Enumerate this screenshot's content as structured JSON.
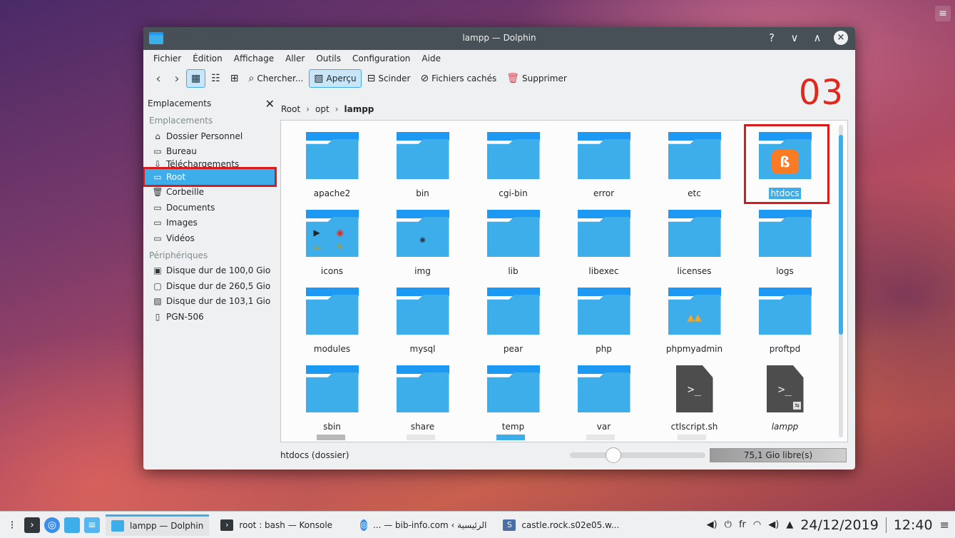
{
  "window": {
    "title": "lampp — Dolphin",
    "controls": [
      "?",
      "∨",
      "∧",
      "×"
    ]
  },
  "menubar": [
    "Fichier",
    "Édition",
    "Affichage",
    "Aller",
    "Outils",
    "Configuration",
    "Aide"
  ],
  "toolbar": {
    "search": "Chercher...",
    "preview": "Aperçu",
    "split": "Scinder",
    "hidden": "Fichiers cachés",
    "delete": "Supprimer"
  },
  "annotation": "03",
  "sidebar": {
    "header": "Emplacements",
    "close": "✕",
    "section_places": "Emplacements",
    "places": [
      {
        "label": "Dossier Personnel",
        "icon": "home-icon"
      },
      {
        "label": "Bureau",
        "icon": "desktop-icon"
      },
      {
        "label": "Téléchargements",
        "icon": "download-icon"
      },
      {
        "label": "Root",
        "icon": "folder-red-icon"
      },
      {
        "label": "Corbeille",
        "icon": "trash-icon"
      },
      {
        "label": "Documents",
        "icon": "folder-icon"
      },
      {
        "label": "Images",
        "icon": "folder-icon"
      },
      {
        "label": "Vidéos",
        "icon": "folder-icon"
      }
    ],
    "section_devices": "Périphériques",
    "devices": [
      {
        "label": "Disque dur de 100,0 Gio",
        "icon": "drive-icon"
      },
      {
        "label": "Disque dur de 260,5 Gio",
        "icon": "drive-icon"
      },
      {
        "label": "Disque dur de 103,1 Gio",
        "icon": "drive-icon"
      },
      {
        "label": "PGN-506",
        "icon": "phone-icon"
      }
    ]
  },
  "breadcrumb": [
    "Root",
    "opt",
    "lampp"
  ],
  "files": [
    {
      "name": "apache2",
      "type": "folder"
    },
    {
      "name": "bin",
      "type": "folder"
    },
    {
      "name": "cgi-bin",
      "type": "folder"
    },
    {
      "name": "error",
      "type": "folder"
    },
    {
      "name": "etc",
      "type": "folder"
    },
    {
      "name": "htdocs",
      "type": "folder-xampp",
      "selected": true
    },
    {
      "name": "icons",
      "type": "folder-icons"
    },
    {
      "name": "img",
      "type": "folder-img"
    },
    {
      "name": "lib",
      "type": "folder"
    },
    {
      "name": "libexec",
      "type": "folder"
    },
    {
      "name": "licenses",
      "type": "folder"
    },
    {
      "name": "logs",
      "type": "folder"
    },
    {
      "name": "modules",
      "type": "folder"
    },
    {
      "name": "mysql",
      "type": "folder"
    },
    {
      "name": "pear",
      "type": "folder"
    },
    {
      "name": "php",
      "type": "folder"
    },
    {
      "name": "phpmyadmin",
      "type": "folder-pma"
    },
    {
      "name": "proftpd",
      "type": "folder"
    },
    {
      "name": "sbin",
      "type": "folder"
    },
    {
      "name": "share",
      "type": "folder"
    },
    {
      "name": "temp",
      "type": "folder"
    },
    {
      "name": "var",
      "type": "folder"
    },
    {
      "name": "ctlscript.sh",
      "type": "script"
    },
    {
      "name": "lampp",
      "type": "script-link"
    }
  ],
  "statusbar": {
    "info": "htdocs (dossier)",
    "free": "75,1 Gio libre(s)",
    "zoom_fraction": 0.3
  },
  "taskbar": {
    "tasks": [
      {
        "label": "lampp — Dolphin",
        "active": true
      },
      {
        "label": "root : bash — Konsole",
        "active": false
      },
      {
        "label": "... — bib-info.com ‹ الرئيسية",
        "active": false
      },
      {
        "label": "castle.rock.s02e05.w...",
        "active": false
      }
    ],
    "lang": "fr",
    "date": "24/12/2019",
    "time": "12:40"
  },
  "colors": {
    "accent": "#3daee9",
    "folder_tab": "#1d99f3",
    "highlight": "#d81b1b",
    "titlebar": "#475057"
  }
}
